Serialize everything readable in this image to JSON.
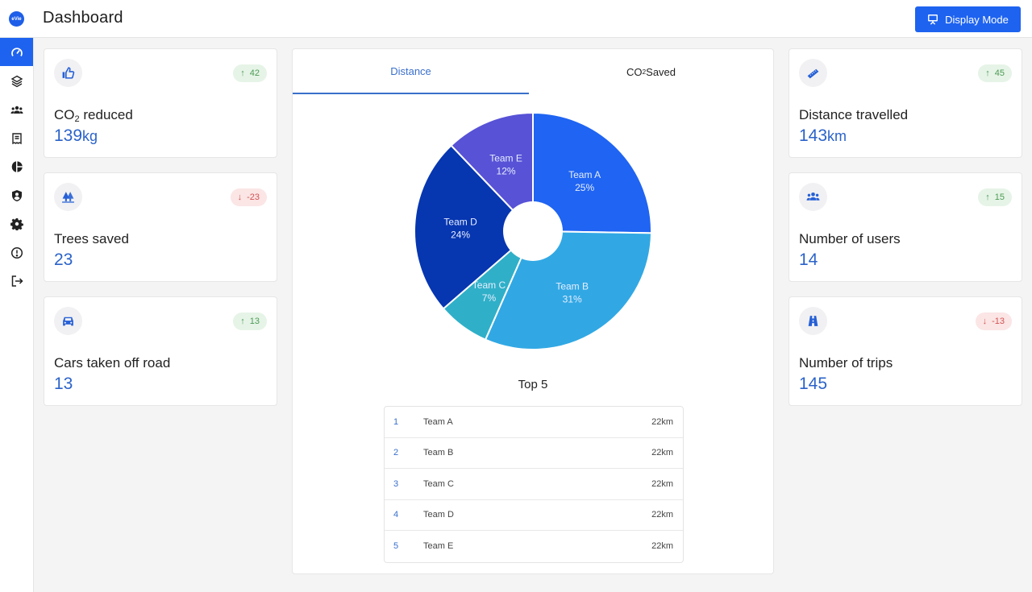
{
  "app": {
    "logo_text": "eVie",
    "title": "Dashboard"
  },
  "header": {
    "display_mode_label": "Display Mode"
  },
  "sidebar": {
    "items": [
      {
        "name": "dashboard",
        "icon": "speedometer-icon",
        "active": true
      },
      {
        "name": "layers",
        "icon": "layers-icon",
        "active": false
      },
      {
        "name": "teams",
        "icon": "users-icon",
        "active": false
      },
      {
        "name": "reports",
        "icon": "receipt-icon",
        "active": false
      },
      {
        "name": "analytics",
        "icon": "pie-chart-icon",
        "active": false
      },
      {
        "name": "security",
        "icon": "shield-user-icon",
        "active": false
      },
      {
        "name": "settings",
        "icon": "gear-icon",
        "active": false
      },
      {
        "name": "alerts",
        "icon": "alert-circle-icon",
        "active": false
      },
      {
        "name": "logout",
        "icon": "logout-icon",
        "active": false
      }
    ]
  },
  "left_cards": [
    {
      "icon": "thumbs-up-icon",
      "label_main": "CO",
      "label_sub": "2",
      "label_rest": " reduced",
      "value": "139",
      "unit": "kg",
      "trend": "up",
      "delta": "42"
    },
    {
      "icon": "trees-icon",
      "label_main": "Trees saved",
      "label_sub": "",
      "label_rest": "",
      "value": "23",
      "unit": "",
      "trend": "down",
      "delta": "-23"
    },
    {
      "icon": "car-icon",
      "label_main": "Cars taken off road",
      "label_sub": "",
      "label_rest": "",
      "value": "13",
      "unit": "",
      "trend": "up",
      "delta": "13"
    }
  ],
  "right_cards": [
    {
      "icon": "ruler-icon",
      "label_main": "Distance travelled",
      "label_sub": "",
      "label_rest": "",
      "value": "143",
      "unit": "km",
      "trend": "up",
      "delta": "45"
    },
    {
      "icon": "users-icon",
      "label_main": "Number of users",
      "label_sub": "",
      "label_rest": "",
      "value": "14",
      "unit": "",
      "trend": "up",
      "delta": "15"
    },
    {
      "icon": "road-icon",
      "label_main": "Number of trips",
      "label_sub": "",
      "label_rest": "",
      "value": "145",
      "unit": "",
      "trend": "down",
      "delta": "-13"
    }
  ],
  "tabs": [
    {
      "label_main": "Distance",
      "label_sub": "",
      "label_rest": "",
      "active": true
    },
    {
      "label_main": "CO",
      "label_sub": "2",
      "label_rest": " Saved",
      "active": false
    }
  ],
  "chart_data": {
    "type": "pie",
    "title": "",
    "donut_hole": true,
    "categories": [
      "Team A",
      "Team B",
      "Team C",
      "Team D",
      "Team E"
    ],
    "values": [
      25,
      31,
      7,
      24,
      12
    ],
    "value_labels": [
      "25%",
      "31%",
      "7%",
      "24%",
      "12%"
    ],
    "colors": [
      "#1f64f2",
      "#31a8e4",
      "#2fb0c8",
      "#0636b0",
      "#5752d6"
    ],
    "start": "top",
    "direction": "clockwise"
  },
  "top5": {
    "title": "Top 5",
    "rows": [
      {
        "rank": "1",
        "team": "Team A",
        "value": "22km"
      },
      {
        "rank": "2",
        "team": "Team B",
        "value": "22km"
      },
      {
        "rank": "3",
        "team": "Team C",
        "value": "22km"
      },
      {
        "rank": "4",
        "team": "Team D",
        "value": "22km"
      },
      {
        "rank": "5",
        "team": "Team E",
        "value": "22km"
      }
    ]
  },
  "colors": {
    "accent": "#1e63f0",
    "value_text": "#2b63c9",
    "up": "#4c9a55",
    "down": "#d25353"
  }
}
